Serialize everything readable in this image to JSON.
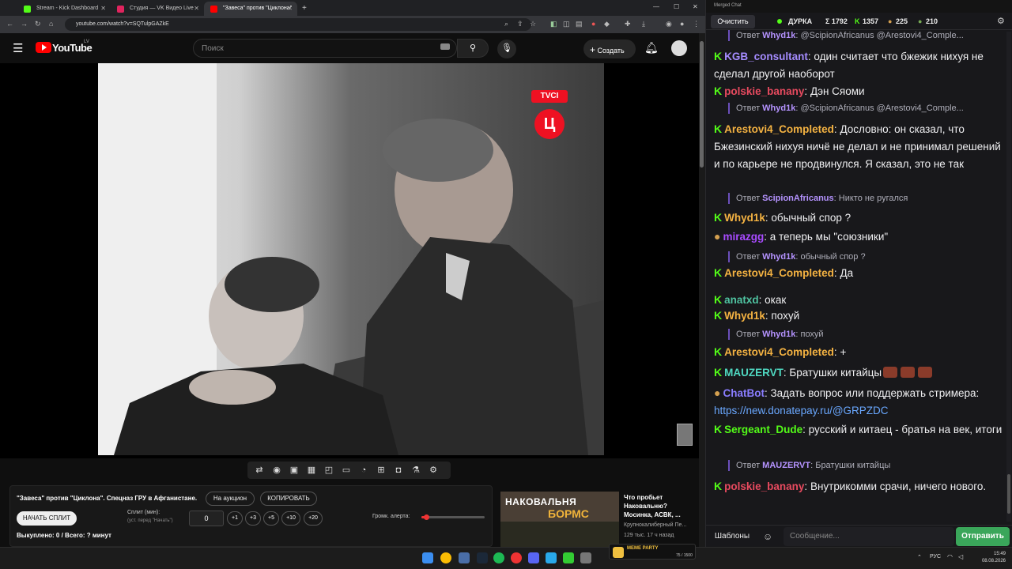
{
  "browser": {
    "tabs": [
      {
        "label": "Stream - Kick Dashboard",
        "color": "#53fc18"
      },
      {
        "label": "Студия — VK Видео Live",
        "color": "#e0245e"
      },
      {
        "label": "\"Завеса\" против \"Циклона\"",
        "color": "#ff0000"
      }
    ],
    "url": "youtube.com/watch?v=SQTulpGAZkE"
  },
  "youtube": {
    "logo": "YouTube",
    "region": "LV",
    "search_placeholder": "Поиск",
    "create_label": "Создать"
  },
  "video": {
    "channel_logo": "TVCI",
    "channel_mark": "Ц"
  },
  "panel": {
    "title": "\"Завеса\" против \"Циклона\". Спецназ ГРУ в Афганистане.",
    "auction_label": "На аукцион",
    "copy_label": "КОПИРОВАТЬ",
    "start_split_label": "НАЧАТЬ СПЛИТ",
    "split_label": "Сплит (мин):",
    "split_hint": "(уст. перед \"Начать\")",
    "split_value": "0",
    "increments": [
      "+1",
      "+3",
      "+5",
      "+10",
      "+20"
    ],
    "alert_volume_label": "Громк. алерта:",
    "alert_volume_level": 0.07,
    "bought_text": "Выкуплено: 0 / Всего: ? минут"
  },
  "recommended": {
    "thumb_text": "НАКОВАЛЬНЯ",
    "thumb_text2": "БОРМС",
    "title": "Что пробьет Наковальню? Мосинка, АСВК, ...",
    "channel": "Крупнокалиберный Пе...",
    "meta": "129 тыс.   17 ч назад"
  },
  "chat": {
    "window_title": "Merged Chat",
    "clear_label": "Очистить",
    "stats": {
      "name": "ДУРКА",
      "total": "Σ 1792",
      "kick": "1357",
      "vk": "225",
      "other": "210"
    },
    "messages": [
      {
        "type": "reply",
        "label": "Ответ",
        "user": "Whyd1k",
        "color": "#b593ff",
        "text": "@ScipionAfricanus @Arestovi4_Comple..."
      },
      {
        "type": "msg",
        "badge": "K",
        "user": "KGB_consultant",
        "color": "#a58cff",
        "text": "один считает что бжежик нихуя не сделал другой наоборот"
      },
      {
        "type": "msg",
        "badge": "K",
        "user": "polskie_banany",
        "color": "#e84a5f",
        "text": "Дэн Сяоми"
      },
      {
        "type": "reply",
        "label": "Ответ",
        "user": "Whyd1k",
        "color": "#b593ff",
        "text": "@ScipionAfricanus @Arestovi4_Comple..."
      },
      {
        "type": "msg",
        "badge": "K",
        "user": "Arestovi4_Completed",
        "color": "#f5b342",
        "text": "Дословно: он сказал, что Бжезинский нихуя ничё не делал и не принимал решений и по карьере не продвинулся. Я сказал, это не так"
      },
      {
        "type": "reply",
        "label": "Ответ",
        "user": "ScipionAfricanus",
        "color": "#b593ff",
        "text": "Никто не ругался"
      },
      {
        "type": "msg",
        "badge": "K",
        "user": "Whyd1k",
        "color": "#f5b342",
        "text": "обычный спор ?"
      },
      {
        "type": "msg",
        "badge": "vk",
        "user": "mirazgg",
        "color": "#a84bff",
        "text": "а теперь мы \"союзники\""
      },
      {
        "type": "reply",
        "label": "Ответ",
        "user": "Whyd1k",
        "color": "#b593ff",
        "text": "обычный спор ?"
      },
      {
        "type": "msg",
        "badge": "K",
        "user": "Arestovi4_Completed",
        "color": "#f5b342",
        "text": "Да"
      },
      {
        "type": "msg",
        "badge": "K",
        "user": "anatxd",
        "color": "#4fc3a1",
        "text": "окак"
      },
      {
        "type": "msg",
        "badge": "K",
        "user": "Whyd1k",
        "color": "#f5b342",
        "text": "похуй"
      },
      {
        "type": "reply",
        "label": "Ответ",
        "user": "Whyd1k",
        "color": "#b593ff",
        "text": "похуй"
      },
      {
        "type": "msg",
        "badge": "K",
        "user": "Arestovi4_Completed",
        "color": "#f5b342",
        "text": "+"
      },
      {
        "type": "msg",
        "badge": "K",
        "user": "MAUZERVT",
        "color": "#4fd8c1",
        "text": "Братушки китайцы"
      },
      {
        "type": "msg",
        "badge": "vk",
        "user": "ChatBot",
        "color": "#8a7dff",
        "text": "Задать вопрос или поддержать стримера:",
        "link": "https://new.donatepay.ru/@GRPZDC"
      },
      {
        "type": "msg",
        "badge": "K",
        "user": "Sergeant_Dude",
        "color": "#53fc18",
        "text": "русский и китаец - братья на век, итоги"
      },
      {
        "type": "reply",
        "label": "Ответ",
        "user": "MAUZERVT",
        "color": "#b593ff",
        "text": "Братушки китайцы"
      },
      {
        "type": "msg",
        "badge": "K",
        "user": "polskie_banany",
        "color": "#e84a5f",
        "text": "Внутрикомми срачи, ничего нового."
      }
    ],
    "templates_label": "Шаблоны",
    "input_placeholder": "Сообщение...",
    "send_label": "Отправить"
  },
  "taskbar": {
    "widget_label": "МЕМЕ PARTY",
    "widget_value": "75 / 1500",
    "lang": "РУС",
    "time": "15:49",
    "date": "08.08.2026"
  }
}
